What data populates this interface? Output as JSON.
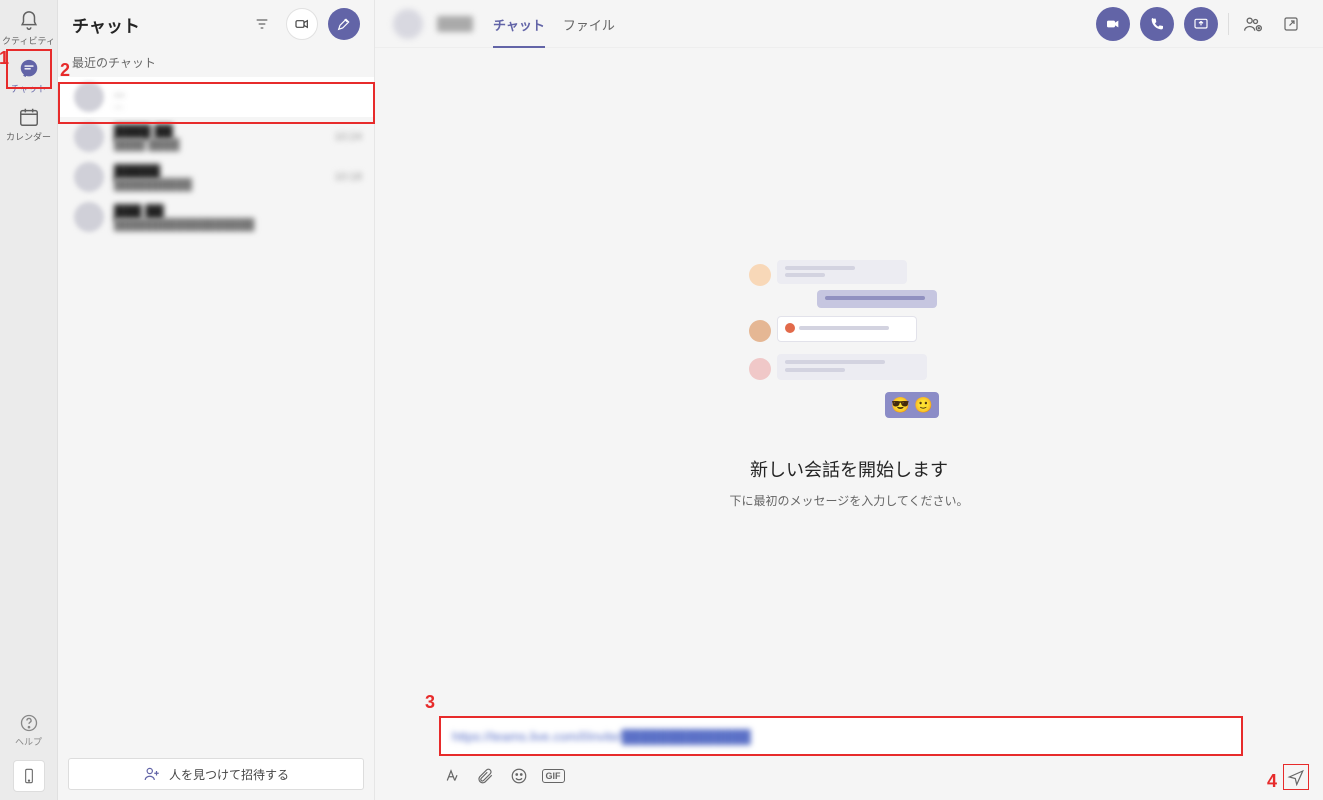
{
  "rail": {
    "activity": "クティビティ",
    "chat": "チャット",
    "calendar": "カレンダー",
    "help": "ヘルプ"
  },
  "chat_panel": {
    "title": "チャット",
    "recent_label": "最近のチャット",
    "invite_label": "人を見つけて招待する"
  },
  "chats": [
    {
      "name": "...",
      "preview": "...",
      "time": ""
    },
    {
      "name": "████ ██",
      "preview": "████ ████",
      "time": "10:24"
    },
    {
      "name": "█████",
      "preview": "██████████",
      "time": "10:18"
    },
    {
      "name": "███ ██",
      "preview": "██████████████████",
      "time": ""
    }
  ],
  "conv": {
    "tabs": {
      "chat": "チャット",
      "file": "ファイル"
    },
    "empty_title": "新しい会話を開始します",
    "empty_sub": "下に最初のメッセージを入力してください。",
    "compose_value": "https://teams.live.com/l/invite/██████████████"
  },
  "icons": {
    "filter": "≡",
    "gif": "GIF"
  },
  "annotations": {
    "n1": "1",
    "n2": "2",
    "n3": "3",
    "n4": "4"
  }
}
